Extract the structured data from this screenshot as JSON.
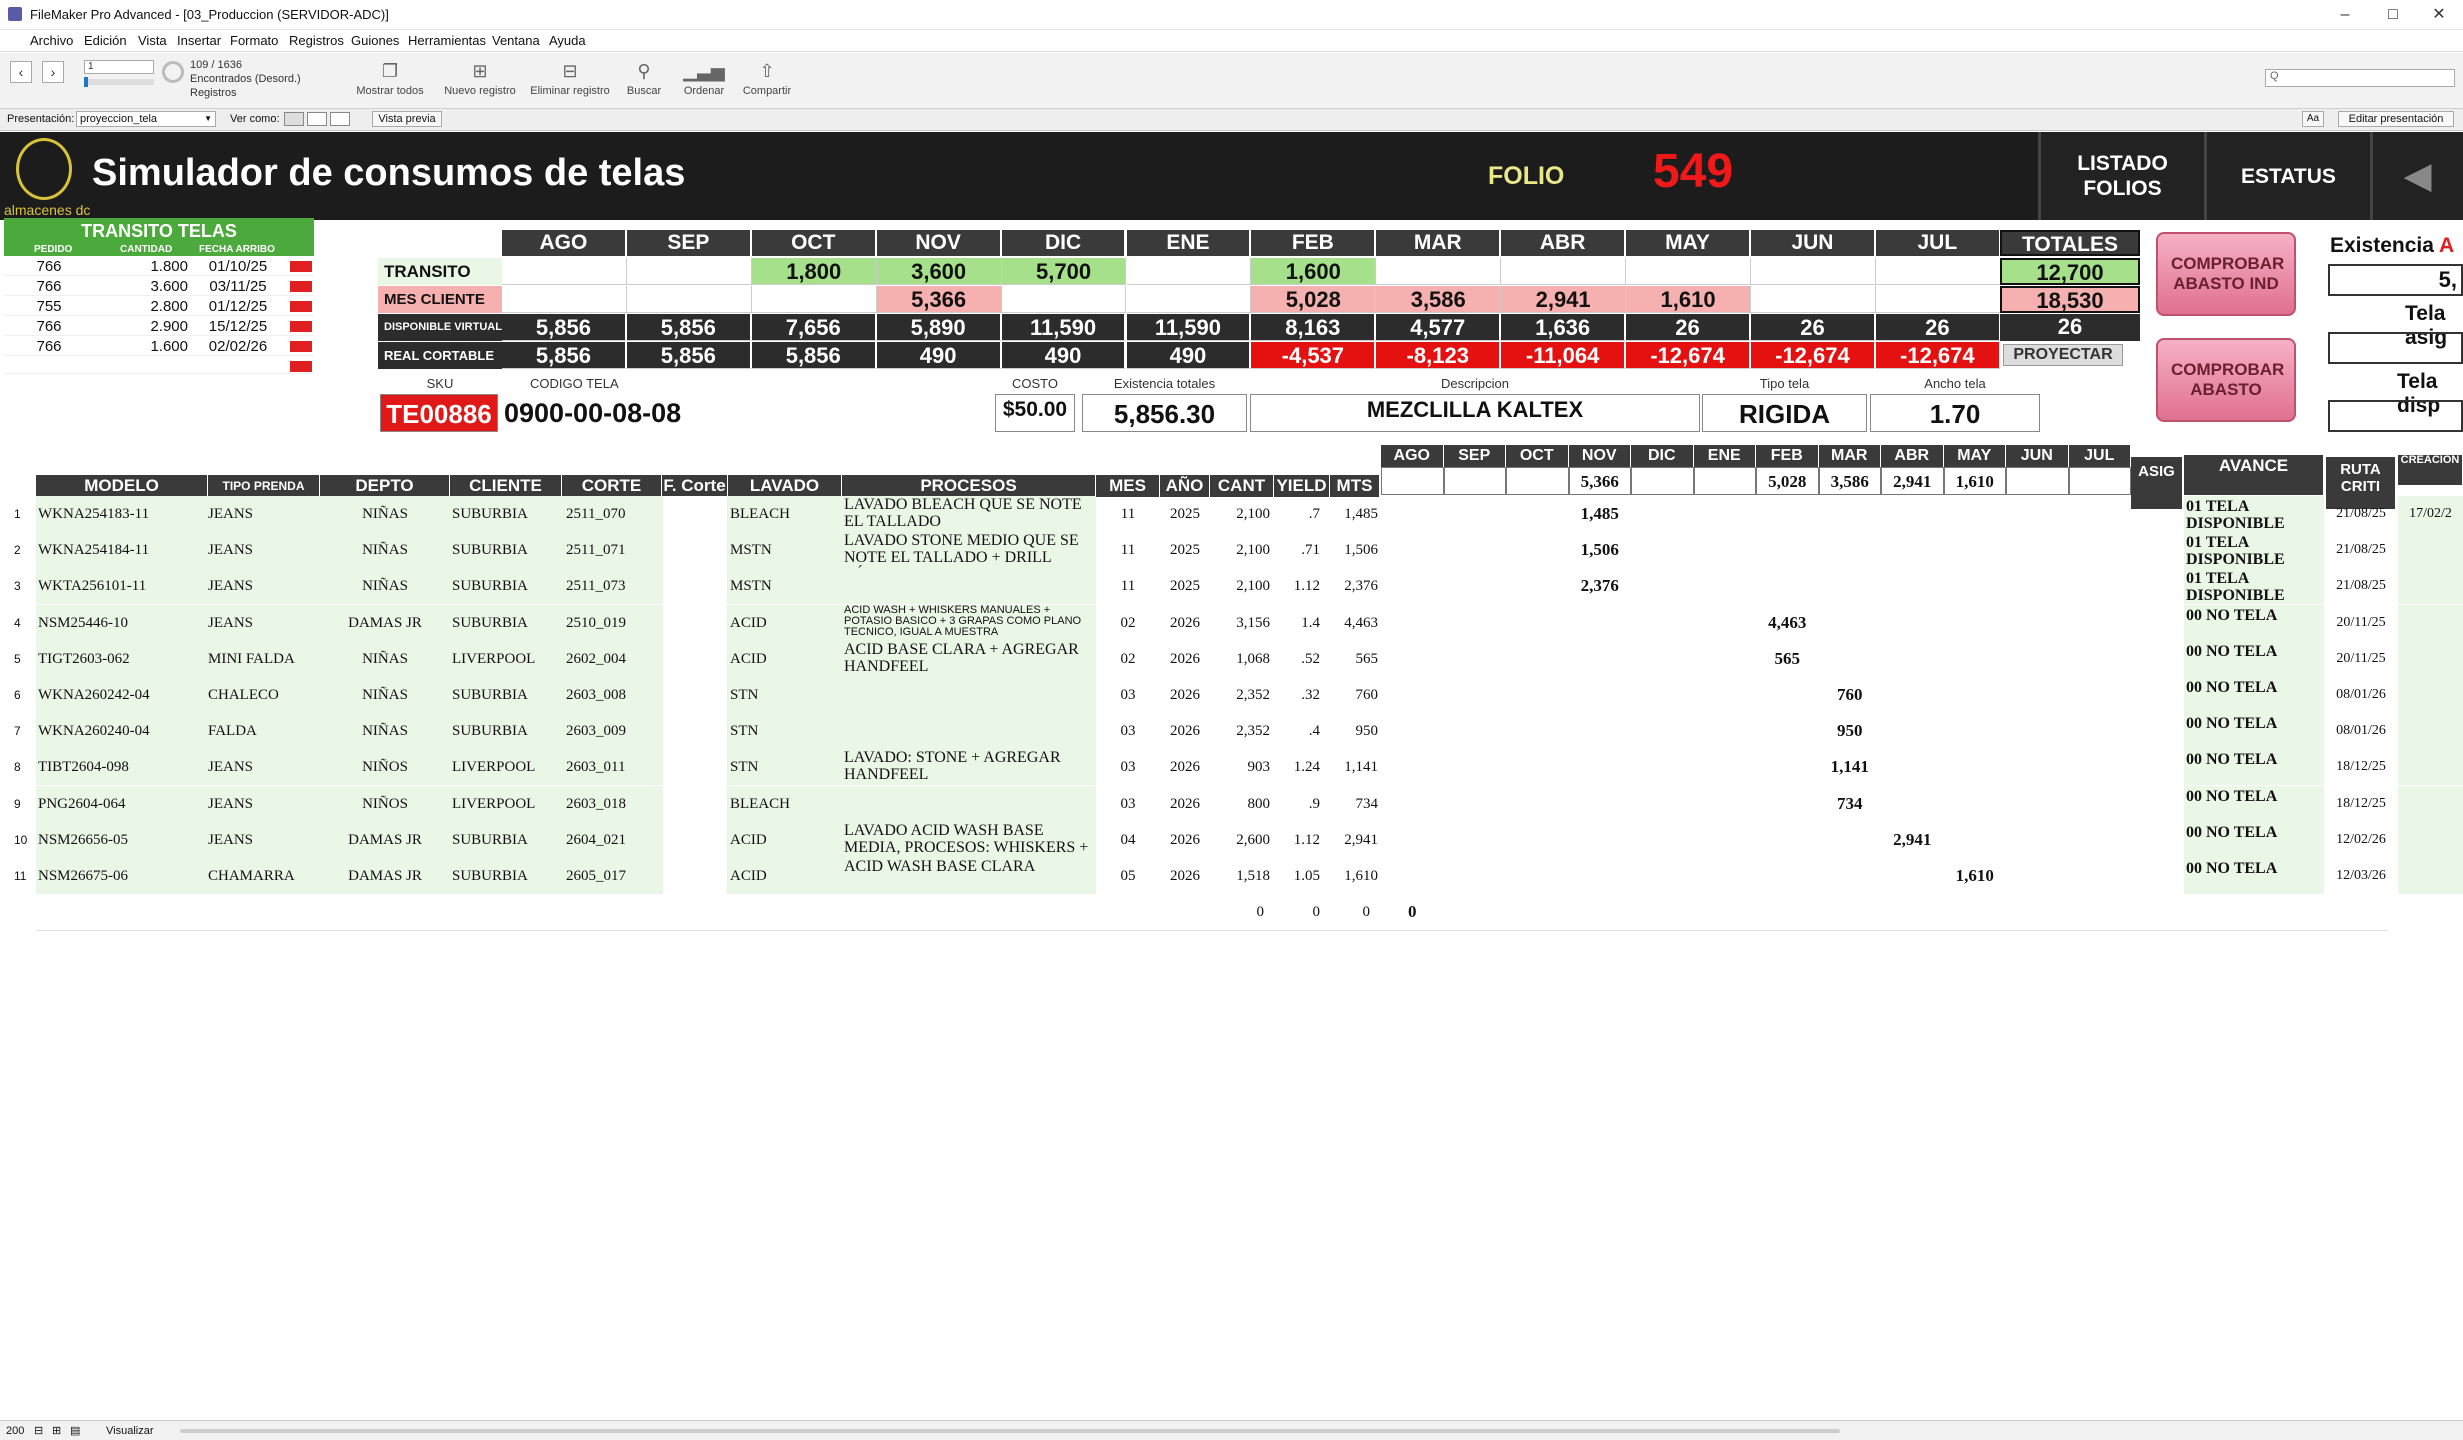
{
  "window": {
    "title": "FileMaker Pro Advanced - [03_Produccion (SERVIDOR-ADC)]"
  },
  "menu": [
    "Archivo",
    "Edición",
    "Vista",
    "Insertar",
    "Formato",
    "Registros",
    "Guiones",
    "Herramientas",
    "Ventana",
    "Ayuda"
  ],
  "toolbar": {
    "record_value": "1",
    "record_total": "109 / 1636",
    "found_text": "Encontrados (Desord.)",
    "records_label": "Registros",
    "show_all": "Mostrar todos",
    "new_record": "Nuevo registro",
    "delete_record": "Eliminar registro",
    "find": "Buscar",
    "sort": "Ordenar",
    "share": "Compartir",
    "search_placeholder": "Q"
  },
  "layoutbar": {
    "label": "Presentación:",
    "layout": "proyeccion_tela",
    "view_as": "Ver como:",
    "preview": "Vista previa",
    "edit_layout": "Editar presentación",
    "aa": "Aa"
  },
  "header": {
    "title": "Simulador de consumos de telas",
    "logo_text": "almacenes dc",
    "folio_label": "FOLIO",
    "folio_value": "549",
    "btn_folios": "LISTADO FOLIOS",
    "btn_estatus": "ESTATUS"
  },
  "transito": {
    "title": "TRANSITO TELAS",
    "cols": [
      "PEDIDO",
      "CANTIDAD",
      "FECHA ARRIBO"
    ],
    "rows": [
      [
        "766",
        "1.800",
        "01/10/25"
      ],
      [
        "766",
        "3.600",
        "03/11/25"
      ],
      [
        "755",
        "2.800",
        "01/12/25"
      ],
      [
        "766",
        "2.900",
        "15/12/25"
      ],
      [
        "766",
        "1.600",
        "02/02/26"
      ]
    ]
  },
  "grid": {
    "months": [
      "AGO",
      "SEP",
      "OCT",
      "NOV",
      "DIC",
      "ENE",
      "FEB",
      "MAR",
      "ABR",
      "MAY",
      "JUN",
      "JUL"
    ],
    "totals_label": "TOTALES",
    "rows": [
      {
        "label": "TRANSITO",
        "values": [
          "",
          "",
          "1,800",
          "3,600",
          "5,700",
          "",
          "1,600",
          "",
          "",
          "",
          "",
          ""
        ],
        "total": "12,700"
      },
      {
        "label": "MES CLIENTE",
        "values": [
          "",
          "",
          "",
          "5,366",
          "",
          "",
          "5,028",
          "3,586",
          "2,941",
          "1,610",
          "",
          ""
        ],
        "total": "18,530"
      },
      {
        "label": "DISPONIBLE VIRTUAL",
        "values": [
          "5,856",
          "5,856",
          "7,656",
          "5,890",
          "11,590",
          "11,590",
          "8,163",
          "4,577",
          "1,636",
          "26",
          "26",
          "26"
        ],
        "total": "26"
      },
      {
        "label": "REAL CORTABLE",
        "values": [
          "5,856",
          "5,856",
          "5,856",
          "490",
          "490",
          "490",
          "-4,537",
          "-8,123",
          "-11,064",
          "-12,674",
          "-12,674",
          "-12,674"
        ],
        "total": "PROYECTAR"
      }
    ]
  },
  "side": {
    "btn_ind": "COMPROBAR ABASTO IND",
    "btn_abasto": "COMPROBAR ABASTO",
    "existencia": "Existencia",
    "existencia_accent": "A",
    "existencia_val": "5,",
    "tela_asig": "Tela asig",
    "tela_disp": "Tela disp"
  },
  "fabric": {
    "sku_label": "SKU",
    "sku": "TE00886",
    "codigo_label": "CODIGO TELA",
    "codigo": "0900-00-08-08",
    "costo_label": "COSTO",
    "costo": "$50.00",
    "exist_label": "Existencia totales",
    "exist": "5,856.30",
    "desc_label": "Descripcion",
    "desc": "MEZCLILLA KALTEX",
    "tipo_label": "Tipo tela",
    "tipo": "RIGIDA",
    "ancho_label": "Ancho tela",
    "ancho": "1.70"
  },
  "table": {
    "headers": [
      "MODELO",
      "TIPO PRENDA",
      "DEPTO",
      "CLIENTE",
      "CORTE",
      "F. Corte",
      "LAVADO",
      "PROCESOS",
      "MES",
      "AÑO",
      "CANT",
      "YIELD",
      "MTS"
    ],
    "month_headers": [
      "AGO",
      "SEP",
      "OCT",
      "NOV",
      "DIC",
      "ENE",
      "FEB",
      "MAR",
      "ABR",
      "MAY",
      "JUN",
      "JUL"
    ],
    "month_totals": [
      "",
      "",
      "",
      "5,366",
      "",
      "",
      "5,028",
      "3,586",
      "2,941",
      "1,610",
      "",
      ""
    ],
    "right_headers": [
      "ASIG",
      "AVANCE",
      "RUTA CRITI",
      "CREACION"
    ],
    "rows": [
      {
        "n": "1",
        "modelo": "WKNA254183-11",
        "tipo": "JEANS",
        "depto": "NIÑAS",
        "cliente": "SUBURBIA",
        "corte": "2511_070",
        "lavado": "BLEACH",
        "procesos": "LAVADO BLEACH QUE SE NOTE EL TALLADO",
        "mes": "11",
        "anio": "2025",
        "cant": "2,100",
        "yield": ".7",
        "mts": "1,485",
        "mi": 3,
        "mval": "1,485",
        "avance": "01 TELA DISPONIBLE",
        "ruta": "21/08/25",
        "crea": "17/02/2"
      },
      {
        "n": "2",
        "modelo": "WKNA254184-11",
        "tipo": "JEANS",
        "depto": "NIÑAS",
        "cliente": "SUBURBIA",
        "corte": "2511_071",
        "lavado": "MSTN",
        "procesos": "LAVADO STONE MEDIO QUE SE NOTE EL TALLADO + DRILL LÁSER",
        "mes": "11",
        "anio": "2025",
        "cant": "2,100",
        "yield": ".71",
        "mts": "1,506",
        "mi": 3,
        "mval": "1,506",
        "avance": "01 TELA DISPONIBLE",
        "ruta": "21/08/25",
        "crea": ""
      },
      {
        "n": "3",
        "modelo": "WKTA256101-11",
        "tipo": "JEANS",
        "depto": "NIÑAS",
        "cliente": "SUBURBIA",
        "corte": "2511_073",
        "lavado": "MSTN",
        "procesos": "",
        "mes": "11",
        "anio": "2025",
        "cant": "2,100",
        "yield": "1.12",
        "mts": "2,376",
        "mi": 3,
        "mval": "2,376",
        "avance": "01 TELA DISPONIBLE",
        "ruta": "21/08/25",
        "crea": ""
      },
      {
        "n": "4",
        "modelo": "NSM25446-10",
        "tipo": "JEANS",
        "depto": "DAMAS JR",
        "cliente": "SUBURBIA",
        "corte": "2510_019",
        "lavado": "ACID",
        "procesos": "ACID WASH + WHISKERS MANUALES + POTASIO BASICO + 3 GRAPAS COMO PLANO TECNICO, IGUAL A MUESTRA",
        "mes": "02",
        "anio": "2026",
        "cant": "3,156",
        "yield": "1.4",
        "mts": "4,463",
        "mi": 6,
        "mval": "4,463",
        "avance": "00 NO TELA",
        "ruta": "20/11/25",
        "crea": ""
      },
      {
        "n": "5",
        "modelo": "TIGT2603-062",
        "tipo": "MINI FALDA",
        "depto": "NIÑAS",
        "cliente": "LIVERPOOL",
        "corte": "2602_004",
        "lavado": "ACID",
        "procesos": "ACID BASE CLARA + AGREGAR HANDFEEL",
        "mes": "02",
        "anio": "2026",
        "cant": "1,068",
        "yield": ".52",
        "mts": "565",
        "mi": 6,
        "mval": "565",
        "avance": "00 NO TELA",
        "ruta": "20/11/25",
        "crea": ""
      },
      {
        "n": "6",
        "modelo": "WKNA260242-04",
        "tipo": "CHALECO",
        "depto": "NIÑAS",
        "cliente": "SUBURBIA",
        "corte": "2603_008",
        "lavado": "STN",
        "procesos": "",
        "mes": "03",
        "anio": "2026",
        "cant": "2,352",
        "yield": ".32",
        "mts": "760",
        "mi": 7,
        "mval": "760",
        "avance": "00 NO TELA",
        "ruta": "08/01/26",
        "crea": ""
      },
      {
        "n": "7",
        "modelo": "WKNA260240-04",
        "tipo": "FALDA",
        "depto": "NIÑAS",
        "cliente": "SUBURBIA",
        "corte": "2603_009",
        "lavado": "STN",
        "procesos": "",
        "mes": "03",
        "anio": "2026",
        "cant": "2,352",
        "yield": ".4",
        "mts": "950",
        "mi": 7,
        "mval": "950",
        "avance": "00 NO TELA",
        "ruta": "08/01/26",
        "crea": ""
      },
      {
        "n": "8",
        "modelo": "TIBT2604-098",
        "tipo": "JEANS",
        "depto": "NIÑOS",
        "cliente": "LIVERPOOL",
        "corte": "2603_011",
        "lavado": "STN",
        "procesos": "LAVADO: STONE + AGREGAR HANDFEEL",
        "mes": "03",
        "anio": "2026",
        "cant": "903",
        "yield": "1.24",
        "mts": "1,141",
        "mi": 7,
        "mval": "1,141",
        "avance": "00 NO TELA",
        "ruta": "18/12/25",
        "crea": ""
      },
      {
        "n": "9",
        "modelo": "PNG2604-064",
        "tipo": "JEANS",
        "depto": "NIÑOS",
        "cliente": "LIVERPOOL",
        "corte": "2603_018",
        "lavado": "BLEACH",
        "procesos": "",
        "mes": "03",
        "anio": "2026",
        "cant": "800",
        "yield": ".9",
        "mts": "734",
        "mi": 7,
        "mval": "734",
        "avance": "00 NO TELA",
        "ruta": "18/12/25",
        "crea": ""
      },
      {
        "n": "10",
        "modelo": "NSM26656-05",
        "tipo": "JEANS",
        "depto": "DAMAS JR",
        "cliente": "SUBURBIA",
        "corte": "2604_021",
        "lavado": "ACID",
        "procesos": "LAVADO ACID WASH BASE MEDIA, PROCESOS: WHISKERS +",
        "mes": "04",
        "anio": "2026",
        "cant": "2,600",
        "yield": "1.12",
        "mts": "2,941",
        "mi": 8,
        "mval": "2,941",
        "avance": "00 NO TELA",
        "ruta": "12/02/26",
        "crea": ""
      },
      {
        "n": "11",
        "modelo": "NSM26675-06",
        "tipo": "CHAMARRA",
        "depto": "DAMAS JR",
        "cliente": "SUBURBIA",
        "corte": "2605_017",
        "lavado": "ACID",
        "procesos": "ACID WASH BASE CLARA",
        "mes": "05",
        "anio": "2026",
        "cant": "1,518",
        "yield": "1.05",
        "mts": "1,610",
        "mi": 9,
        "mval": "1,610",
        "avance": "00 NO TELA",
        "ruta": "12/03/26",
        "crea": ""
      }
    ],
    "footer": {
      "cant": "0",
      "yield": "0",
      "mts": "0",
      "ago": "0"
    }
  },
  "status": {
    "zoom": "200",
    "mode": "Visualizar"
  }
}
